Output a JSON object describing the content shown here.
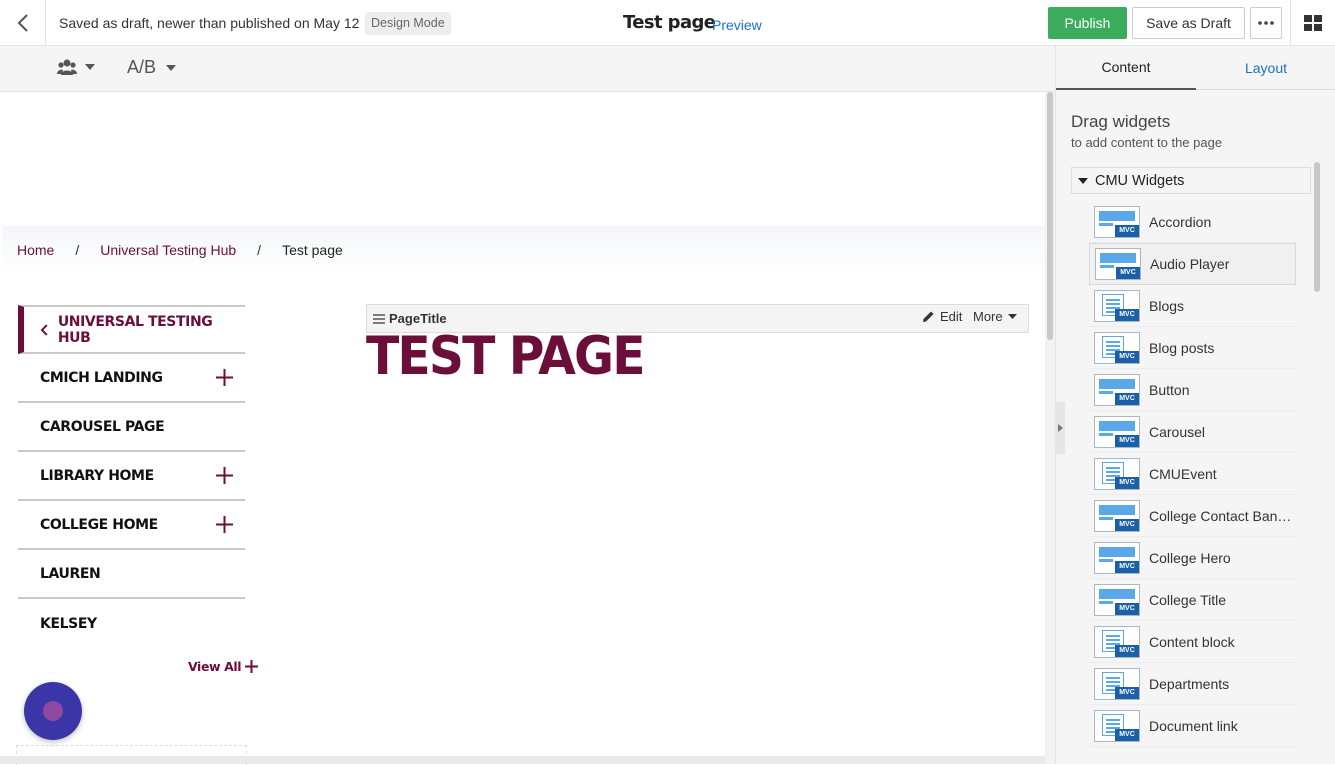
{
  "topbar": {
    "status": "Saved as draft, newer than published on May 12",
    "mode_badge": "Design Mode",
    "page_name": "Test page",
    "preview": "Preview",
    "publish": "Publish",
    "save_draft": "Save as Draft"
  },
  "toolbar": {
    "ab_label": "A/B"
  },
  "breadcrumb": {
    "items": [
      "Home",
      "Universal Testing Hub",
      "Test page"
    ],
    "separator": "/"
  },
  "leftnav": {
    "parent": "UNIVERSAL TESTING HUB",
    "items": [
      {
        "label": "CMICH LANDING",
        "expandable": true
      },
      {
        "label": "CAROUSEL PAGE",
        "expandable": false
      },
      {
        "label": "LIBRARY HOME",
        "expandable": true
      },
      {
        "label": "COLLEGE HOME",
        "expandable": true
      },
      {
        "label": "LAUREN",
        "expandable": false
      },
      {
        "label": "KELSEY",
        "expandable": false
      }
    ],
    "view_all": "View All"
  },
  "widget": {
    "name": "PageTitle",
    "edit": "Edit",
    "more": "More",
    "heading": "TEST PAGE"
  },
  "panel": {
    "tab_content": "Content",
    "tab_layout": "Layout",
    "title": "Drag widgets",
    "subtitle": "to add content to the page",
    "group": "CMU Widgets",
    "widgets": [
      {
        "label": "Accordion",
        "icon": "layout"
      },
      {
        "label": "Audio Player",
        "icon": "layout"
      },
      {
        "label": "Blogs",
        "icon": "list"
      },
      {
        "label": "Blog posts",
        "icon": "list"
      },
      {
        "label": "Button",
        "icon": "layout"
      },
      {
        "label": "Carousel",
        "icon": "layout"
      },
      {
        "label": "CMUEvent",
        "icon": "list"
      },
      {
        "label": "College Contact Bann...",
        "icon": "layout"
      },
      {
        "label": "College Hero",
        "icon": "layout"
      },
      {
        "label": "College Title",
        "icon": "layout"
      },
      {
        "label": "Content block",
        "icon": "list"
      },
      {
        "label": "Departments",
        "icon": "list"
      },
      {
        "label": "Document link",
        "icon": "list"
      }
    ],
    "mvc_badge": "MVC"
  },
  "colors": {
    "brand": "#6b0f3a",
    "publish": "#3aac5c",
    "link": "#1a73c8"
  }
}
